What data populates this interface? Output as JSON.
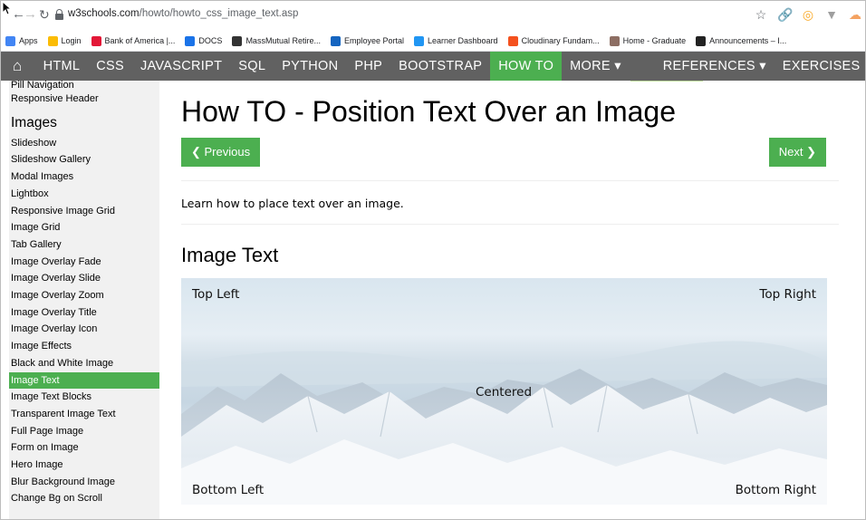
{
  "browser": {
    "url_domain": "w3schools.com",
    "url_path": "/howto/howto_css_image_text.asp",
    "bookmarks": [
      {
        "label": "Apps",
        "icon": "apps-grid-icon",
        "color": "#4285f4"
      },
      {
        "label": "Login",
        "icon": "login-flag-icon",
        "color": "#fbbc05"
      },
      {
        "label": "Bank of America |...",
        "icon": "bofa-icon",
        "color": "#e31837"
      },
      {
        "label": "DOCS",
        "icon": "docs-icon",
        "color": "#1a73e8"
      },
      {
        "label": "MassMutual Retire...",
        "icon": "massmutual-icon",
        "color": "#333333"
      },
      {
        "label": "Employee Portal",
        "icon": "portal-triangle-icon",
        "color": "#1565c0"
      },
      {
        "label": "Learner Dashboard",
        "icon": "learner-icon",
        "color": "#2196f3"
      },
      {
        "label": "Cloudinary Fundam...",
        "icon": "cloudinary-icon",
        "color": "#f4511e"
      },
      {
        "label": "Home - Graduate",
        "icon": "graduate-icon",
        "color": "#8d6e63"
      },
      {
        "label": "Announcements – I...",
        "icon": "blackboard-icon",
        "color": "#222222"
      }
    ]
  },
  "topnav": {
    "items": [
      "HTML",
      "CSS",
      "JAVASCRIPT",
      "SQL",
      "PYTHON",
      "PHP",
      "BOOTSTRAP",
      "HOW TO",
      "MORE ▾",
      "REFERENCES ▾",
      "EXERCISES"
    ],
    "active": "HOW TO",
    "accent": "#4CAF50"
  },
  "sidebar": {
    "pre_items": [
      "Pill Navigation",
      "Responsive Header"
    ],
    "heading": "Images",
    "items": [
      "Slideshow",
      "Slideshow Gallery",
      "Modal Images",
      "Lightbox",
      "Responsive Image Grid",
      "Image Grid",
      "Tab Gallery",
      "Image Overlay Fade",
      "Image Overlay Slide",
      "Image Overlay Zoom",
      "Image Overlay Title",
      "Image Overlay Icon",
      "Image Effects",
      "Black and White Image",
      "Image Text",
      "Image Text Blocks",
      "Transparent Image Text",
      "Full Page Image",
      "Form on Image",
      "Hero Image",
      "Blur Background Image",
      "Change Bg on Scroll"
    ],
    "active": "Image Text"
  },
  "main": {
    "title": "How TO - Position Text Over an Image",
    "prev_label": "❮ Previous",
    "next_label": "Next ❯",
    "intro": "Learn how to place text over an image.",
    "section_title": "Image Text",
    "captions": {
      "top_left": "Top Left",
      "top_right": "Top Right",
      "centered": "Centered",
      "bottom_left": "Bottom Left",
      "bottom_right": "Bottom Right"
    }
  }
}
